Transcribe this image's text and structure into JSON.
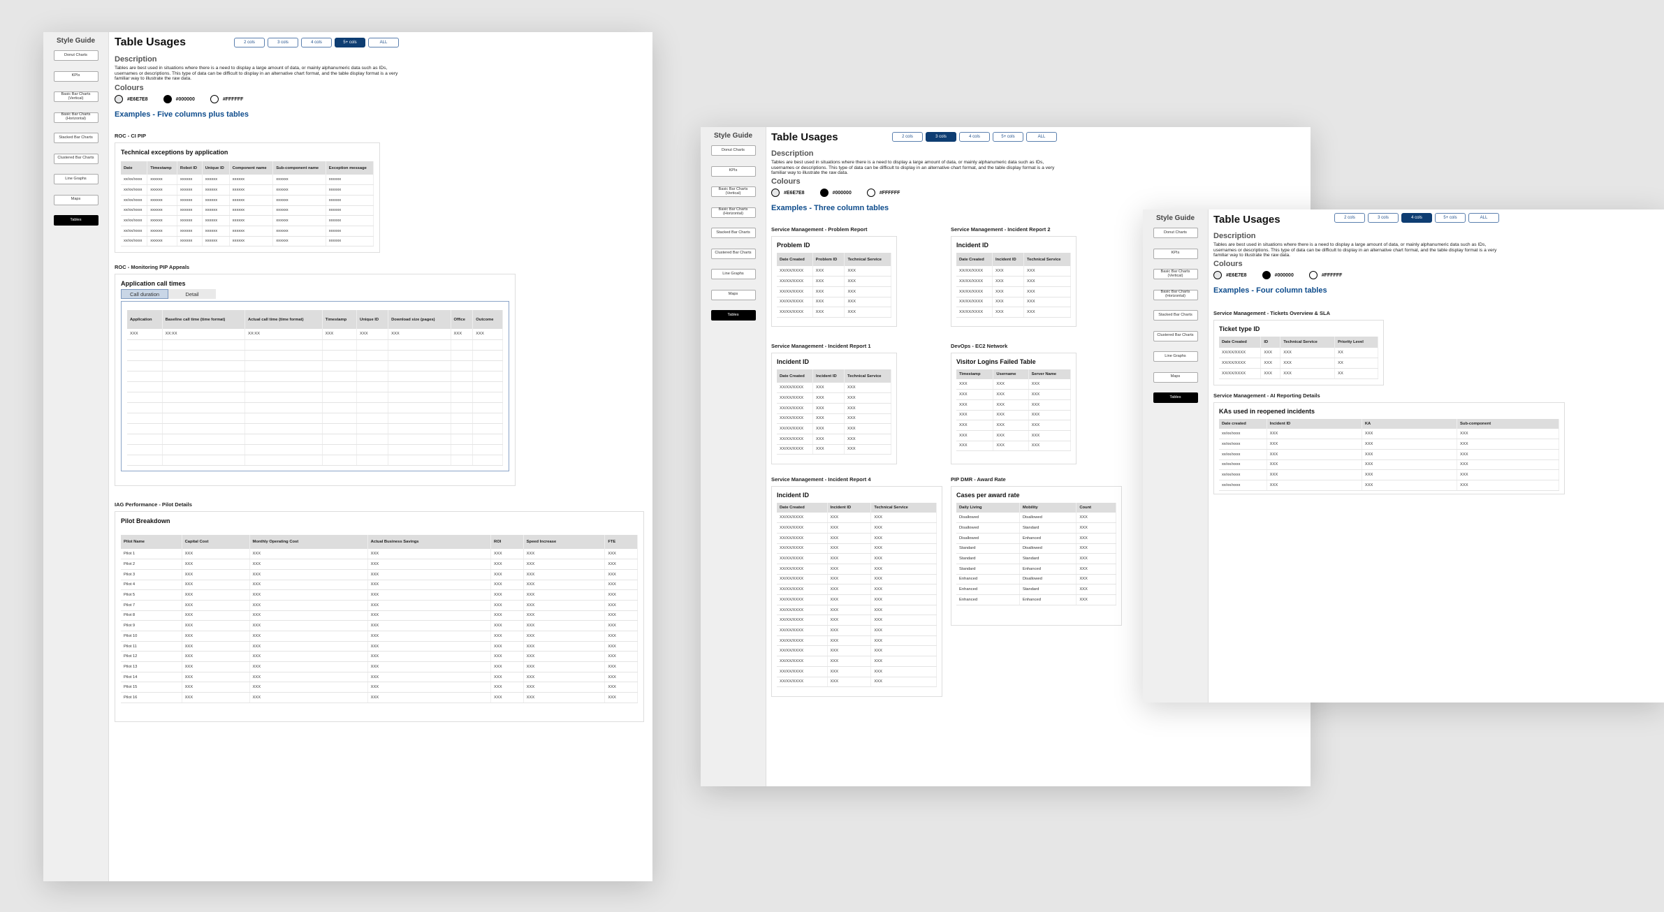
{
  "sidebar": {
    "title": "Style Guide",
    "items": [
      "Donut Charts",
      "KPIs",
      "Basic Bar Charts (Vertical)",
      "Basic Bar Charts (Horizontal)",
      "Stacked Bar Charts",
      "Clustered Bar Charts",
      "Line Graphs",
      "Maps",
      "Tables"
    ]
  },
  "common": {
    "title": "Table Usages",
    "tabs": [
      "2 cols",
      "3 cols",
      "4 cols",
      "5+ cols",
      "ALL"
    ],
    "desc_heading": "Description",
    "desc_text": "Tables are best used in situations where there is a need to display a large amount of data, or mainly alphanumeric data such as IDs, usernames or descriptions. This type of data can be difficult to display in an alternative chart format, and the table display format is a very familiar way to illustrate the raw data.",
    "colours_heading": "Colours",
    "swatches": [
      {
        "label": "#E6E7E8",
        "color": "#E6E7E8"
      },
      {
        "label": "#000000",
        "color": "#000000"
      },
      {
        "label": "#FFFFFF",
        "color": "#FFFFFF"
      }
    ]
  },
  "board1": {
    "examples_title": "Examples - Five columns plus tables",
    "s1": {
      "label": "ROC - CI PIP",
      "card_title": "Technical exceptions by application",
      "headers": [
        "Date",
        "Timestamp",
        "Robot ID",
        "Unique ID",
        "Component name",
        "Sub-component name",
        "Exception message"
      ],
      "rows": [
        [
          "xx/xx/xxxx",
          "xxxxxx",
          "xxxxxx",
          "xxxxxx",
          "xxxxxx",
          "xxxxxx",
          "xxxxxx"
        ],
        [
          "xx/xx/xxxx",
          "xxxxxx",
          "xxxxxx",
          "xxxxxx",
          "xxxxxx",
          "xxxxxx",
          "xxxxxx"
        ],
        [
          "xx/xx/xxxx",
          "xxxxxx",
          "xxxxxx",
          "xxxxxx",
          "xxxxxx",
          "xxxxxx",
          "xxxxxx"
        ],
        [
          "xx/xx/xxxx",
          "xxxxxx",
          "xxxxxx",
          "xxxxxx",
          "xxxxxx",
          "xxxxxx",
          "xxxxxx"
        ],
        [
          "xx/xx/xxxx",
          "xxxxxx",
          "xxxxxx",
          "xxxxxx",
          "xxxxxx",
          "xxxxxx",
          "xxxxxx"
        ],
        [
          "xx/xx/xxxx",
          "xxxxxx",
          "xxxxxx",
          "xxxxxx",
          "xxxxxx",
          "xxxxxx",
          "xxxxxx"
        ],
        [
          "xx/xx/xxxx",
          "xxxxxx",
          "xxxxxx",
          "xxxxxx",
          "xxxxxx",
          "xxxxxx",
          "xxxxxx"
        ]
      ]
    },
    "s2": {
      "label": "ROC - Monitoring PIP Appeals",
      "card_title": "Application call times",
      "ptabs": [
        "Call duration",
        "Detail"
      ],
      "headers": [
        "Application",
        "Baseline call time (time format)",
        "Actual call time (time format)",
        "Timestamp",
        "Unique ID",
        "Download size (pages)",
        "Office",
        "Outcome"
      ],
      "rows": [
        [
          "XXX",
          "XX:XX",
          "XX:XX",
          "XXX",
          "XXX",
          "XXX",
          "XXX",
          "XXX"
        ]
      ]
    },
    "s3": {
      "label": "IAG Performance - Pilot Details",
      "card_title": "Pilot Breakdown",
      "headers": [
        "Pilot Name",
        "Capital Cost",
        "Monthly Operating Cost",
        "Actual Business Savings",
        "ROI",
        "Speed Increase",
        "FTE"
      ],
      "names": [
        "Pilot 1",
        "Pilot 2",
        "Pilot 3",
        "Pilot 4",
        "Pilot 5",
        "Pilot 7",
        "Pilot 8",
        "Pilot 9",
        "Pilot 10",
        "Pilot 11",
        "Pilot 12",
        "Pilot 13",
        "Pilot 14",
        "Pilot 15",
        "Pilot 16"
      ],
      "cell": "XXX"
    }
  },
  "board2": {
    "examples_title": "Examples - Three column tables",
    "cards": [
      {
        "label": "Service Management - Problem Report",
        "title": "Problem ID",
        "headers": [
          "Date Created",
          "Problem ID",
          "Technical Service"
        ],
        "row": [
          "XX/XX/XXXX",
          "XXX",
          "XXX"
        ],
        "count": 5
      },
      {
        "label": "Service Management - Incident Report 2",
        "title": "Incident ID",
        "headers": [
          "Date Created",
          "Incident ID",
          "Technical Service"
        ],
        "row": [
          "XX/XX/XXXX",
          "XXX",
          "XXX"
        ],
        "count": 5
      },
      {
        "label": "Service Management - Incident Report 1",
        "title": "Incident ID",
        "headers": [
          "Date Created",
          "Incident ID",
          "Technical Service"
        ],
        "row": [
          "XX/XX/XXXX",
          "XXX",
          "XXX"
        ],
        "count": 7
      },
      {
        "label": "DevOps - EC2 Network",
        "title": "Visitor Logins Failed Table",
        "headers": [
          "Timestamp",
          "Username",
          "Server Name"
        ],
        "row": [
          "XXX",
          "XXX",
          "XXX"
        ],
        "count": 7
      },
      {
        "label": "Service Management - Incident Report 4",
        "title": "Incident ID",
        "headers": [
          "Date Created",
          "Incident ID",
          "Technical Service"
        ],
        "row": [
          "XX/XX/XXXX",
          "XXX",
          "XXX"
        ],
        "count": 17
      },
      {
        "label": "PIP DMR - Award Rate",
        "title": "Cases per award rate",
        "headers": [
          "Daily Living",
          "Mobility",
          "Count"
        ],
        "row": [
          "",
          "",
          "XXX"
        ],
        "count": 10
      }
    ],
    "award_rows": [
      [
        "Disallowed",
        "Disallowed"
      ],
      [
        "Disallowed",
        "Standard"
      ],
      [
        "Disallowed",
        "Enhanced"
      ],
      [
        "Standard",
        "Disallowed"
      ],
      [
        "Standard",
        "Standard"
      ],
      [
        "Standard",
        "Enhanced"
      ],
      [
        "Enhanced",
        "Disallowed"
      ],
      [
        "Enhanced",
        "Standard"
      ],
      [
        "Enhanced",
        "Enhanced"
      ]
    ]
  },
  "board3": {
    "examples_title": "Examples - Four column tables",
    "s1": {
      "label": "Service Management - Tickets Overview & SLA",
      "card_title": "Ticket type ID",
      "headers": [
        "Date Created",
        "ID",
        "Technical Service",
        "Priority Level"
      ],
      "rows": [
        [
          "XX/XX/XXXX",
          "XXX",
          "XXX",
          "XX"
        ],
        [
          "XX/XX/XXXX",
          "XXX",
          "XXX",
          "XX"
        ],
        [
          "XX/XX/XXXX",
          "XXX",
          "XXX",
          "XX"
        ]
      ]
    },
    "s2": {
      "label": "Service Management - AI Reporting Details",
      "card_title": "KAs used in reopened incidents",
      "headers": [
        "Date created",
        "Incident ID",
        "KA",
        "Sub-component"
      ],
      "row": [
        "xx/xx/xxxx",
        "XXX",
        "XXX",
        "XXX"
      ],
      "count": 6
    }
  }
}
